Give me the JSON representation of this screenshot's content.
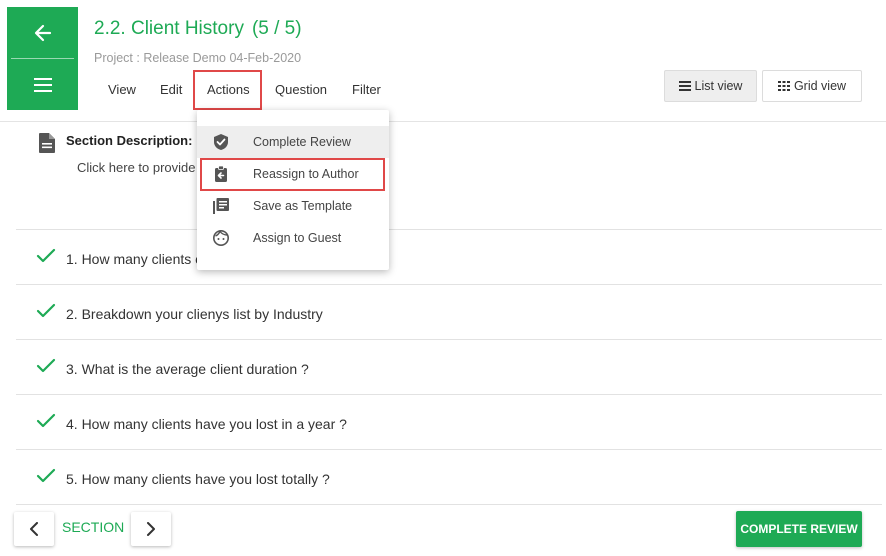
{
  "header": {
    "title": "2.2. Client History",
    "count": "(5 / 5)",
    "project": "Project : Release Demo 04-Feb-2020"
  },
  "nav": {
    "back_icon": "arrow-left-icon",
    "menu_icon": "hamburger-icon"
  },
  "menu": {
    "view": "View",
    "edit": "Edit",
    "actions": "Actions",
    "question": "Question",
    "filter": "Filter"
  },
  "views": {
    "list": "List view",
    "grid": "Grid view"
  },
  "section": {
    "label": "Section Description:",
    "placeholder": "Click here to provide"
  },
  "actions_dropdown": [
    {
      "label": "Complete Review",
      "icon": "shield-check-icon"
    },
    {
      "label": "Reassign to Author",
      "icon": "clipboard-return-icon"
    },
    {
      "label": "Save as Template",
      "icon": "template-icon"
    },
    {
      "label": "Assign to Guest",
      "icon": "guest-face-icon"
    }
  ],
  "questions": [
    {
      "text": "1. How many clients c"
    },
    {
      "text": "2. Breakdown your clienys list by Industry"
    },
    {
      "text": "3. What is the average client duration ?"
    },
    {
      "text": "4. How many clients have you lost in a year ?"
    },
    {
      "text": "5. How many clients have you lost totally ?"
    }
  ],
  "footer": {
    "section_label": "SECTION",
    "complete_button": "COMPLETE REVIEW"
  },
  "colors": {
    "accent": "#1eaa55",
    "highlight": "#e04848"
  }
}
